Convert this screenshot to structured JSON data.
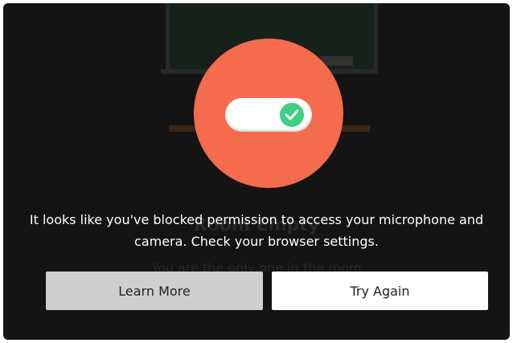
{
  "background": {
    "room_title": "Room Empty",
    "room_subtitle": "You are the only one in the room"
  },
  "dialog": {
    "icon": "toggle-check-icon",
    "message": "It looks like you've blocked permission to access your microphone and camera. Check your browser settings.",
    "learn_more_label": "Learn More",
    "try_again_label": "Try Again"
  },
  "colors": {
    "circle": "#f46b4e",
    "check": "#3fcf82",
    "overlay": "#141414"
  }
}
